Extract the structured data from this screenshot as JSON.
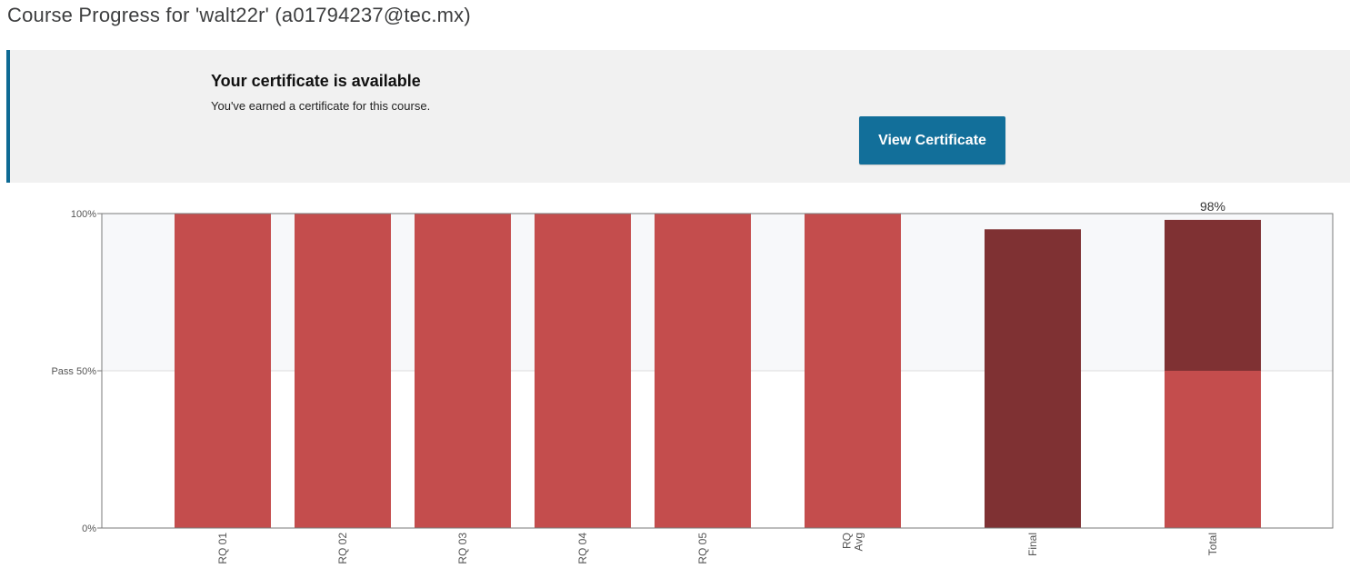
{
  "page": {
    "title": "Course Progress for 'walt22r' (a01794237@tec.mx)"
  },
  "certificate": {
    "heading": "Your certificate is available",
    "message": "You've earned a certificate for this course.",
    "button_label": "View Certificate"
  },
  "colors": {
    "accent": "#126f9a",
    "bar_light": "#c44d4d",
    "bar_dark": "#7f3133",
    "pass_region": "#f7f8fa"
  },
  "chart_data": {
    "type": "bar",
    "categories": [
      "RQ 01",
      "RQ 02",
      "RQ 03",
      "RQ 04",
      "RQ 05",
      "RQ Avg",
      "Final",
      "Total"
    ],
    "category_lines": [
      [
        "RQ 01"
      ],
      [
        "RQ 02"
      ],
      [
        "RQ 03"
      ],
      [
        "RQ 04"
      ],
      [
        "RQ 05"
      ],
      [
        "RQ",
        "Avg"
      ],
      [
        "Final"
      ],
      [
        "Total"
      ]
    ],
    "values": [
      100,
      100,
      100,
      100,
      100,
      100,
      95,
      98
    ],
    "shade": [
      "light",
      "light",
      "light",
      "light",
      "light",
      "light",
      "dark",
      "split"
    ],
    "total_label": "98%",
    "ylim": [
      0,
      100
    ],
    "y_ticks": [
      {
        "value": 0,
        "label": "0%"
      },
      {
        "value": 50,
        "label": "Pass 50%"
      },
      {
        "value": 100,
        "label": "100%"
      }
    ],
    "pass_threshold": 50,
    "grid": false,
    "legend": "none"
  }
}
